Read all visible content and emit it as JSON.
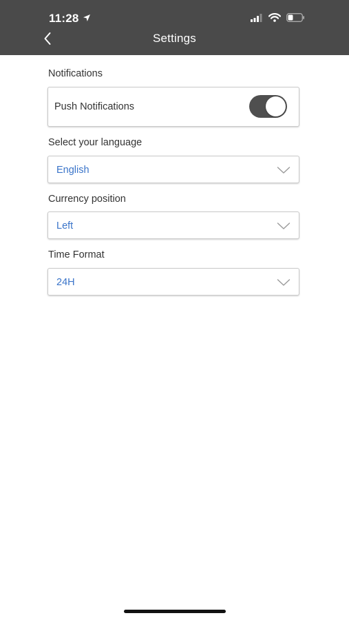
{
  "status_bar": {
    "time": "11:28"
  },
  "header": {
    "title": "Settings"
  },
  "notifications": {
    "section_label": "Notifications",
    "push_label": "Push Notifications",
    "push_enabled": true
  },
  "language": {
    "label": "Select your language",
    "value": "English"
  },
  "currency": {
    "label": "Currency position",
    "value": "Left"
  },
  "time_format": {
    "label": "Time Format",
    "value": "24H"
  },
  "colors": {
    "header_bg": "#4a4a4a",
    "value_text": "#3a74c9",
    "toggle_on": "#4f4f4f"
  }
}
